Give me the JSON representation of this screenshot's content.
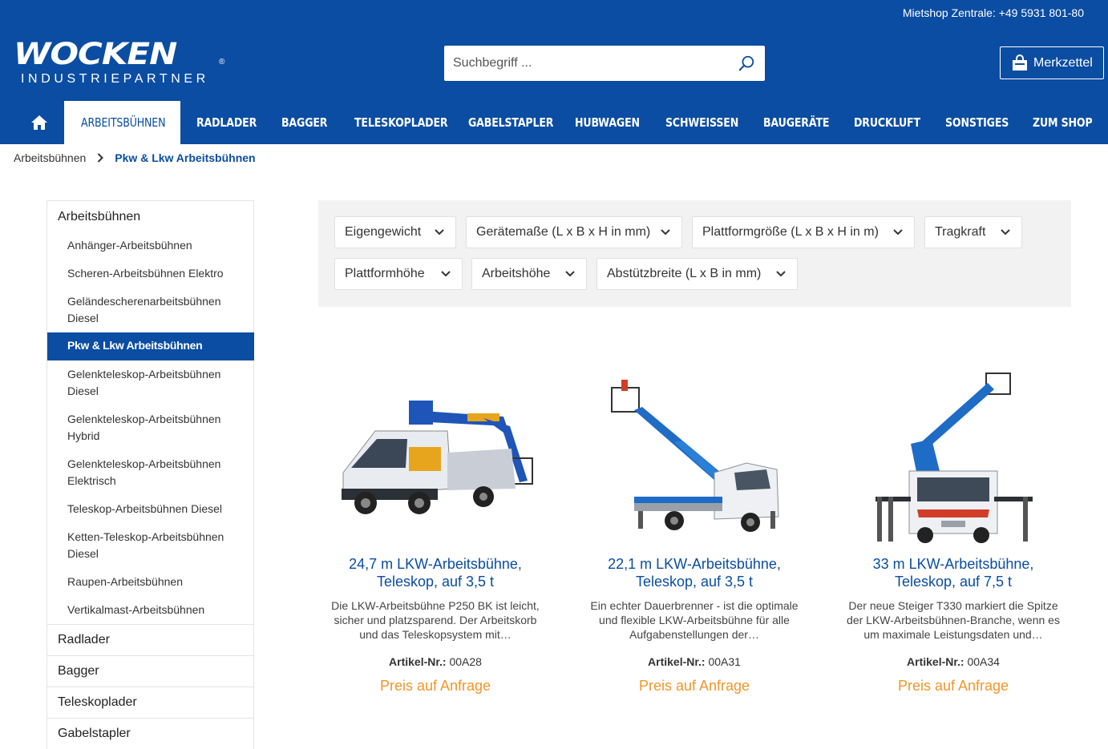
{
  "header": {
    "phone": "Mietshop Zentrale: +49 5931 801-80",
    "logo_main": "WOCKEN",
    "logo_reg": "®",
    "logo_sub": "INDUSTRIEPARTNER",
    "search_placeholder": "Suchbegriff ...",
    "merkzettel": "Merkzettel"
  },
  "nav": {
    "items": [
      "ARBEITSBÜHNEN",
      "RADLADER",
      "BAGGER",
      "TELESKOPLADER",
      "GABELSTAPLER",
      "HUBWAGEN",
      "SCHWEISSEN",
      "BAUGERÄTE",
      "DRUCKLUFT",
      "SONSTIGES",
      "ZUM SHOP"
    ]
  },
  "breadcrumb": {
    "root": "Arbeitsbühnen",
    "current": "Pkw & Lkw Arbeitsbühnen"
  },
  "sidebar": {
    "head": "Arbeitsbühnen",
    "subs": [
      "Anhänger-Arbeitsbühnen",
      "Scheren-Arbeitsbühnen Elektro",
      "Geländescherenarbeitsbühnen Diesel",
      "Gelenkteleskop-Arbeitsbühnen Diesel",
      "Gelenkteleskop-Arbeitsbühnen Hybrid",
      "Gelenkteleskop-Arbeitsbühnen Elektrisch",
      "Teleskop-Arbeitsbühnen Diesel",
      "Ketten-Teleskop-Arbeitsbühnen Diesel",
      "Raupen-Arbeitsbühnen",
      "Vertikalmast-Arbeitsbühnen"
    ],
    "active": "Pkw & Lkw Arbeitsbühnen",
    "mains": [
      "Radlader",
      "Bagger",
      "Teleskoplader",
      "Gabelstapler"
    ]
  },
  "filters": [
    "Eigengewicht",
    "Gerätemaße (L x B x H in mm)",
    "Plattformgröße (L x B x H in m)",
    "Tragkraft",
    "Plattformhöhe",
    "Arbeitshöhe",
    "Abstützbreite (L x B in mm)"
  ],
  "products": [
    {
      "title_1": "24,7 m LKW-Arbeitsbühne,",
      "title_2": "Teleskop, auf 3,5 t",
      "desc_1": "Die LKW-Arbeitsbühne P250 BK ist leicht,",
      "desc_2": "sicher und platzsparend. Der Arbeitskorb",
      "desc_3": "und das Teleskopsystem mit…",
      "art_label": "Artikel-Nr.:",
      "art_no": "00A28",
      "price": "Preis auf Anfrage"
    },
    {
      "title_1": "22,1 m LKW-Arbeitsbühne,",
      "title_2": "Teleskop, auf 3,5 t",
      "desc_1": "Ein echter Dauerbrenner - ist die optimale",
      "desc_2": "und flexible LKW-Arbeitsbühne für alle",
      "desc_3": "Aufgabenstellungen der…",
      "art_label": "Artikel-Nr.:",
      "art_no": "00A31",
      "price": "Preis auf Anfrage"
    },
    {
      "title_1": "33 m LKW-Arbeitsbühne,",
      "title_2": "Teleskop, auf 7,5 t",
      "desc_1": "Der neue Steiger T330 markiert die Spitze",
      "desc_2": "der LKW-Arbeitsbühnen-Branche, wenn es",
      "desc_3": "um maximale Leistungsdaten und…",
      "art_label": "Artikel-Nr.:",
      "art_no": "00A34",
      "price": "Preis auf Anfrage"
    }
  ],
  "colors": {
    "brand_blue": "#0a4da2",
    "price_orange": "#f0962a",
    "filter_bg": "#f2f2f2"
  }
}
